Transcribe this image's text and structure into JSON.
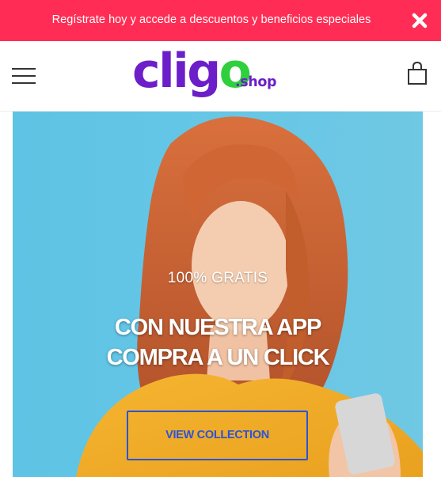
{
  "promo_bar": {
    "text": "Regístrate hoy y accede a descuentos y beneficios especiales",
    "close_icon": "close-x-icon",
    "bg_color": "#ff2d55"
  },
  "header": {
    "menu_icon": "hamburger-menu-icon",
    "logo": {
      "main": "cligo",
      "suffix": ".shop",
      "primary_color": "#6c1fc9",
      "accent_color": "#2fcf3d"
    },
    "cart_icon": "shopping-bag-icon"
  },
  "hero": {
    "tagline": "100% GRATIS",
    "headline_line1": "CON NUESTRA APP",
    "headline_line2": "COMPRA A UN CLICK",
    "cta_label": "VIEW COLLECTION",
    "cta_color": "#2b53d6"
  }
}
